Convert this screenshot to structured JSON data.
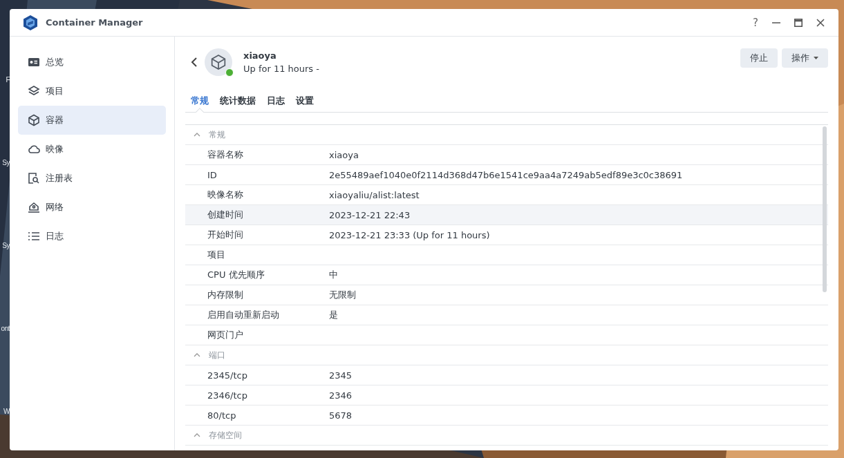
{
  "desktop_labels": [
    {
      "text": "F"
    },
    {
      "text": "Sy"
    },
    {
      "text": "Sy"
    },
    {
      "text": "ont"
    },
    {
      "text": "W"
    }
  ],
  "window": {
    "title": "Container Manager",
    "help": "?"
  },
  "sidebar": {
    "items": [
      {
        "label": "总览",
        "selected": false
      },
      {
        "label": "项目",
        "selected": false
      },
      {
        "label": "容器",
        "selected": true
      },
      {
        "label": "映像",
        "selected": false
      },
      {
        "label": "注册表",
        "selected": false
      },
      {
        "label": "网络",
        "selected": false
      },
      {
        "label": "日志",
        "selected": false
      }
    ]
  },
  "container": {
    "name": "xiaoya",
    "status_text": "Up for 11 hours -",
    "running": true
  },
  "buttons": [
    {
      "label": "停止",
      "dropdown": false
    },
    {
      "label": "操作",
      "dropdown": true
    }
  ],
  "tabs": [
    {
      "label": "常规",
      "selected": true
    },
    {
      "label": "统计数据",
      "selected": false
    },
    {
      "label": "日志",
      "selected": false
    },
    {
      "label": "设置",
      "selected": false
    }
  ],
  "table": {
    "rows": [
      {
        "kind": "section",
        "title": "常规",
        "expanded": true
      },
      {
        "kind": "row",
        "label": "容器名称",
        "value": "xiaoya",
        "hovered": false
      },
      {
        "kind": "row",
        "label": "ID",
        "value": "2e55489aef1040e0f2114d368d47b6e1541ce9aa4a7249ab5edf89e3c0c38691",
        "hovered": false
      },
      {
        "kind": "row",
        "label": "映像名称",
        "value": "xiaoyaliu/alist:latest",
        "hovered": false
      },
      {
        "kind": "row",
        "label": "创建时间",
        "value": "2023-12-21 22:43",
        "hovered": true
      },
      {
        "kind": "row",
        "label": "开始时间",
        "value": "2023-12-21 23:33 (Up for 11 hours)",
        "hovered": false
      },
      {
        "kind": "row",
        "label": "项目",
        "hovered": false
      },
      {
        "kind": "row",
        "label": "CPU 优先顺序",
        "value": "中",
        "hovered": false
      },
      {
        "kind": "row",
        "label": "内存限制",
        "value": "无限制",
        "hovered": false
      },
      {
        "kind": "row",
        "label": "启用自动重新启动",
        "value": "是",
        "hovered": false
      },
      {
        "kind": "row",
        "label": "网页门户",
        "hovered": false
      },
      {
        "kind": "section",
        "title": "端口",
        "expanded": true
      },
      {
        "kind": "row",
        "label": "2345/tcp",
        "value": "2345",
        "hovered": false
      },
      {
        "kind": "row",
        "label": "2346/tcp",
        "value": "2346",
        "hovered": false
      },
      {
        "kind": "row",
        "label": "80/tcp",
        "value": "5678",
        "hovered": false
      },
      {
        "kind": "section",
        "title": "存储空间",
        "expanded": true
      }
    ]
  }
}
